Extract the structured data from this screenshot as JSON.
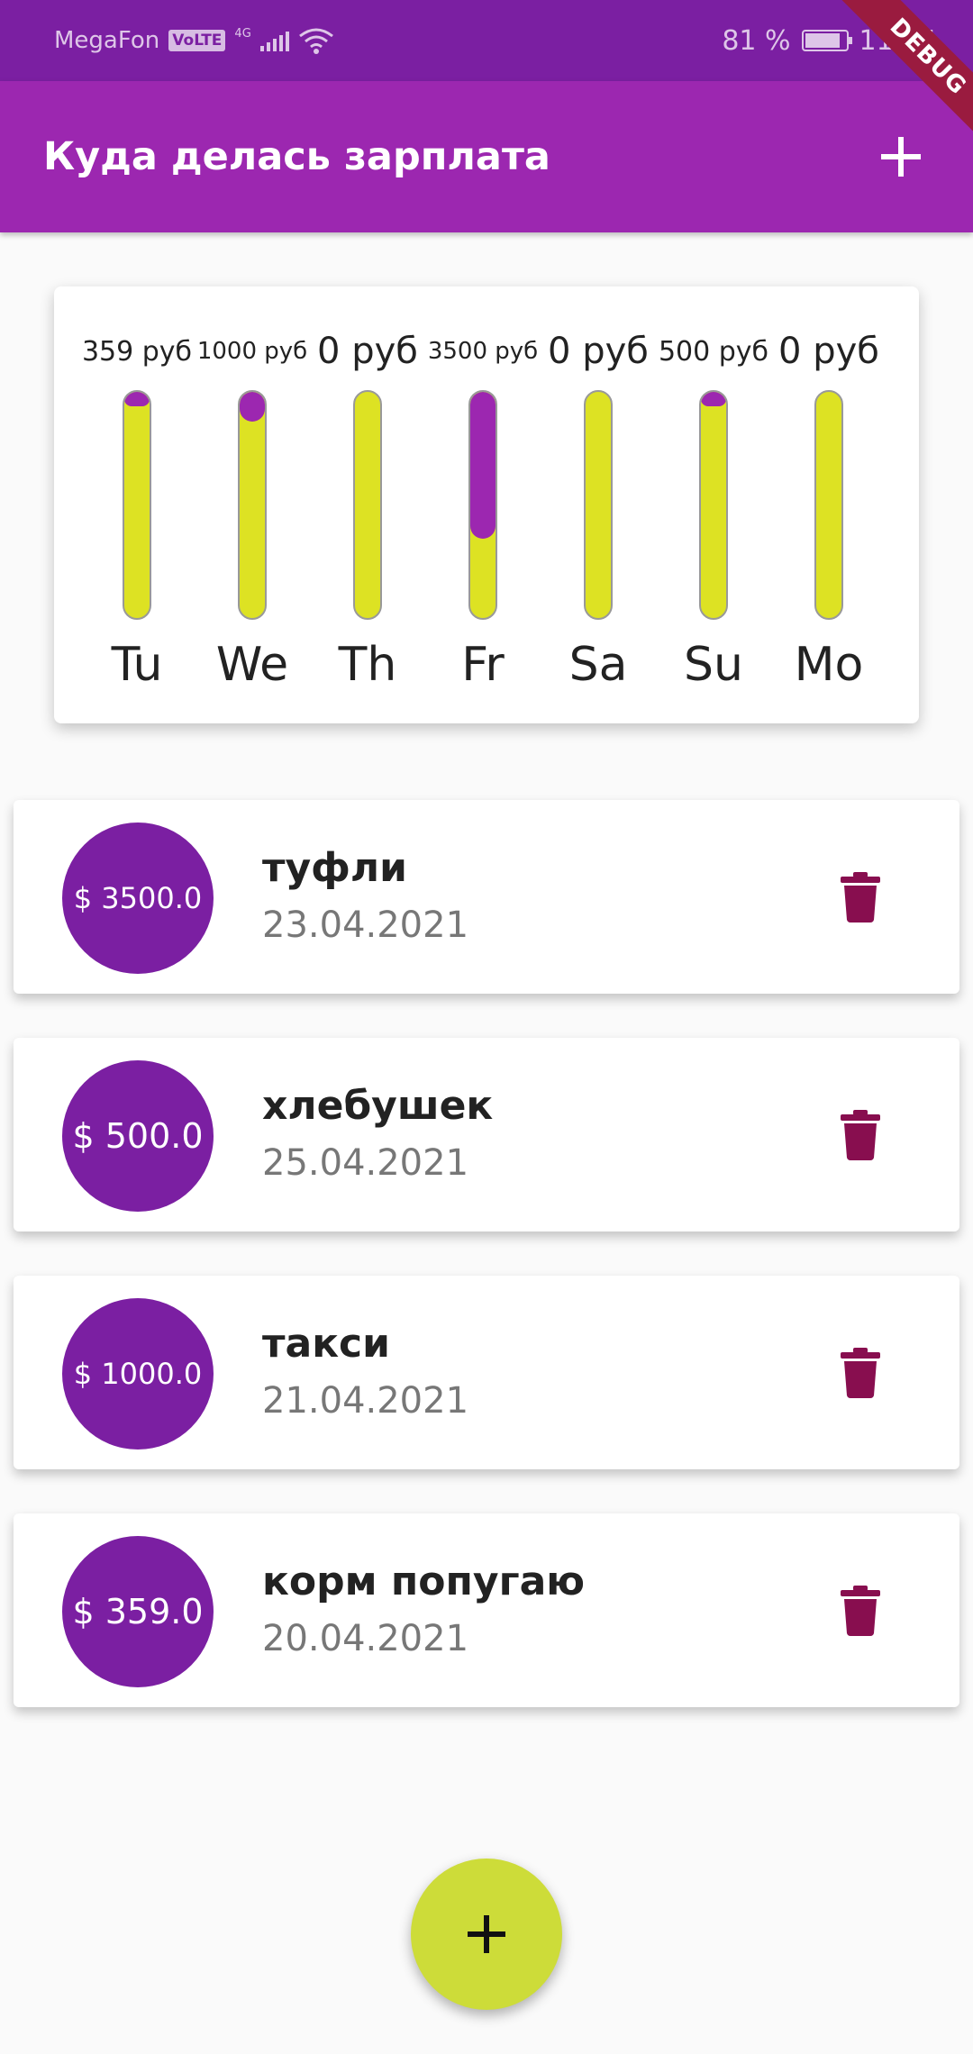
{
  "status_bar": {
    "carrier": "MegaFon",
    "volte": "VoLTE",
    "network": "4G",
    "battery": "81 %",
    "time": "11:04",
    "debug_label": "DEBUG"
  },
  "app_bar": {
    "title": "Куда делась зарплата",
    "add_icon": "plus-icon"
  },
  "chart_data": {
    "type": "bar",
    "categories": [
      "Tu",
      "We",
      "Th",
      "Fr",
      "Sa",
      "Su",
      "Mo"
    ],
    "labels": [
      "359 руб",
      "1000 руб",
      "0 руб",
      "3500 руб",
      "0 руб",
      "500 руб",
      "0 руб"
    ],
    "values": [
      359,
      1000,
      0,
      3500,
      0,
      500,
      0
    ],
    "spending_fraction": [
      0.045,
      0.13,
      0,
      0.65,
      0,
      0.065,
      0
    ],
    "colors": {
      "fill": "#9c27b0",
      "track": "#dde223",
      "border": "#999999"
    }
  },
  "transactions": [
    {
      "amount": "$ 3500.0",
      "title": "туфли",
      "date": "23.04.2021",
      "delete_icon": "trash-icon"
    },
    {
      "amount": "$ 500.0",
      "title": "хлебушек",
      "date": "25.04.2021",
      "delete_icon": "trash-icon"
    },
    {
      "amount": "$ 1000.0",
      "title": "такси",
      "date": "21.04.2021",
      "delete_icon": "trash-icon"
    },
    {
      "amount": "$ 359.0",
      "title": "корм попугаю",
      "date": "20.04.2021",
      "delete_icon": "trash-icon"
    }
  ],
  "fab": {
    "icon": "plus-icon"
  },
  "colors": {
    "primary": "#9c27b0",
    "primary_dark": "#7b1fa2",
    "accent": "#cddc39",
    "delete": "#880e4f"
  }
}
